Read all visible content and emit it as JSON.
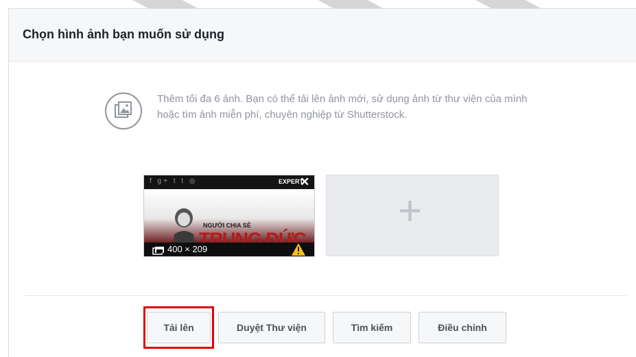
{
  "header": {
    "title": "Chọn hình ảnh bạn muốn sử dụng"
  },
  "info": {
    "icon": "image-gallery-icon",
    "text": "Thêm tối đa 6 ảnh. Bạn có thể tải lên ảnh mới, sử dụng ảnh từ thư viện của mình hoặc tìm ảnh miễn phí, chuyên nghiệp từ Shutterstock."
  },
  "thumbnail": {
    "social_icons": "f g+ t t ◎",
    "expert_label": "EXPERT",
    "close_symbol": "✕",
    "subtitle": "NGƯỜI CHIA SẺ",
    "brand": "TRUNG ĐỨC",
    "dimensions": "400 × 209",
    "warning_icon": "warning-icon"
  },
  "add_image": {
    "symbol": "+"
  },
  "buttons": {
    "upload": "Tải lên",
    "browse_library": "Duyệt Thư viện",
    "search": "Tìm kiếm",
    "adjust": "Điều chỉnh"
  },
  "colors": {
    "highlight": "#e00000",
    "text_muted": "#90949c",
    "title": "#1d2129"
  }
}
